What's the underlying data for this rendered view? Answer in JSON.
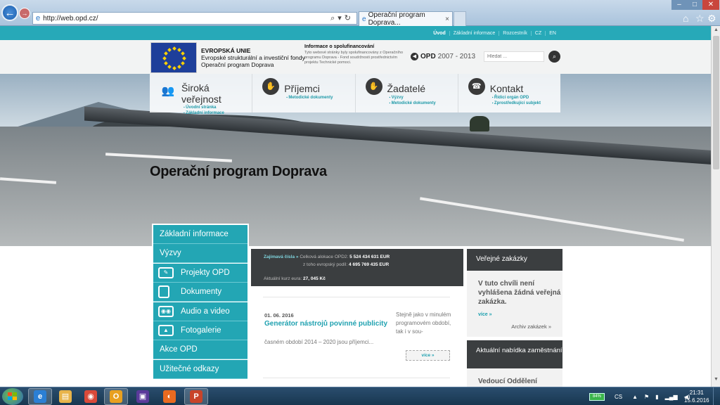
{
  "browser": {
    "url": "http://web.opd.cz/",
    "tab_title": "Operační program Doprava...",
    "tab_close": "×",
    "back_icon": "arrow-left-icon",
    "home_icon": "home-icon",
    "favorites_icon": "star-icon",
    "settings_icon": "gear-icon"
  },
  "topnav": [
    "Úvod",
    "Základní informace",
    "Rozcestník",
    "CZ",
    "EN"
  ],
  "header": {
    "eu_line1": "EVROPSKÁ UNIE",
    "eu_line2": "Evropské strukturální a investiční fondy",
    "eu_line3": "Operační program Doprava",
    "info_title": "Informace o spolufinancování",
    "info_body": "Tyto webové stránky byly spolufinancovány z Operačního programu Doprava - Fond soudržnosti prostřednictvím projektu Technické pomoci.",
    "opd_label": "OPD",
    "opd_years": "2007 - 2013",
    "search_placeholder": "Hledat ..."
  },
  "mainnav": [
    {
      "title": "Široká veřejnost",
      "icon": "people-icon",
      "links": [
        "Úvodní stránka",
        "Základní informace"
      ]
    },
    {
      "title": "Příjemci",
      "icon": "handshake-icon",
      "links": [
        "Metodické dokumenty"
      ]
    },
    {
      "title": "Žadatelé",
      "icon": "hand-icon",
      "links": [
        "Výzvy",
        "Metodické dokumenty"
      ]
    },
    {
      "title": "Kontakt",
      "icon": "phone-icon",
      "links": [
        "Řídicí orgán OPD",
        "Zprostředkující subjekt"
      ]
    }
  ],
  "hero_title": "Operační program Doprava",
  "side_menu": [
    {
      "label": "Základní informace",
      "icon": ""
    },
    {
      "label": "Výzvy",
      "icon": ""
    },
    {
      "label": "Projekty OPD",
      "icon": "edit-icon"
    },
    {
      "label": "Dokumenty",
      "icon": "document-icon"
    },
    {
      "label": "Audio a video",
      "icon": "video-icon"
    },
    {
      "label": "Fotogalerie",
      "icon": "image-icon"
    },
    {
      "label": "Akce OPD",
      "icon": ""
    },
    {
      "label": "Užitečné odkazy",
      "icon": ""
    }
  ],
  "stats": {
    "link": "Zajímavá čísla »",
    "alloc_label": "Celková alokace OPD2:",
    "alloc_value": "5 524 434 631 EUR",
    "eu_label": "z toho evropský podíl:",
    "eu_value": "4 695 769 435 EUR",
    "rate_label": "Aktuální kurz eura:",
    "rate_value": "27, 045 Kč"
  },
  "news": {
    "date": "01. 06. 2016",
    "title": "Generátor nástrojů povinné publicity",
    "lead": "časném období 2014 – 2020 jsou příjemci...",
    "side": "Stejně jako v minulém programovém období, tak i v sou-",
    "more": "více »"
  },
  "tenders": {
    "heading": "Veřejné zakázky",
    "message": "V tuto chvíli není vyhlášena žádná veřejná zakázka.",
    "more": "více »",
    "archive": "Archiv zakázek »"
  },
  "jobs": {
    "heading": "Aktuální nabídka zaměstnání",
    "first": "Vedoucí Oddělení"
  },
  "taskbar": {
    "apps": [
      {
        "name": "internet-explorer",
        "glyph": "e",
        "color": "#2b7fd4",
        "active": true
      },
      {
        "name": "file-explorer",
        "glyph": "▤",
        "color": "#e8b44a",
        "active": false
      },
      {
        "name": "chrome",
        "glyph": "◉",
        "color": "#d94a3a",
        "active": false
      },
      {
        "name": "outlook",
        "glyph": "O",
        "color": "#e8a020",
        "active": true
      },
      {
        "name": "save-app",
        "glyph": "▣",
        "color": "#5a3a9a",
        "active": false
      },
      {
        "name": "firefox",
        "glyph": "◐",
        "color": "#e86a20",
        "active": false
      },
      {
        "name": "powerpoint",
        "glyph": "P",
        "color": "#c8442a",
        "active": true
      }
    ],
    "battery": "84%",
    "lang": "CS",
    "time": "21:31",
    "date": "15.6.2016"
  }
}
